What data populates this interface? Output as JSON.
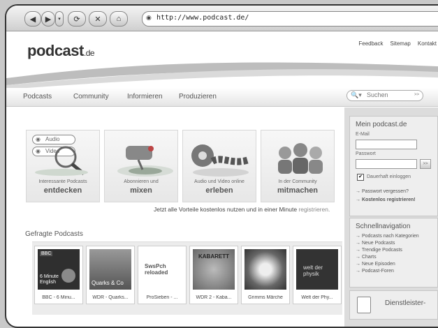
{
  "browser": {
    "url": "http://www.podcast.de/",
    "back_icon": "back-arrow-icon",
    "forward_icon": "forward-arrow-icon"
  },
  "header": {
    "logo_main": "podcast",
    "logo_suffix": ".de",
    "links": [
      "Feedback",
      "Sitemap",
      "Kontakt"
    ]
  },
  "nav": {
    "items": [
      "Podcasts",
      "Community",
      "Informieren",
      "Produzieren"
    ],
    "search_placeholder": "Suchen",
    "search_go": ">>"
  },
  "features": [
    {
      "small": "Interessante Podcasts",
      "big": "entdecken"
    },
    {
      "small": "Abonnieren und",
      "big": "mixen"
    },
    {
      "small": "Audio und Video online",
      "big": "erleben"
    },
    {
      "small": "In der Community",
      "big": "mitmachen"
    }
  ],
  "pills": {
    "audio": "Audio",
    "video": "Video"
  },
  "tagline": {
    "text": "Jetzt alle Vorteile kostenlos nutzen und in einer Minute",
    "link": "registrieren."
  },
  "podcasts_section": {
    "title": "Gefragte Podcasts",
    "items": [
      {
        "caption": "BBC - 6 Minu...",
        "art_text": "6 Minute English",
        "badge": "BBC"
      },
      {
        "caption": "WDR - Quarks...",
        "art_text": "Quarks & Co"
      },
      {
        "caption": "ProSieben - ...",
        "art_text": "SwsPch reloaded"
      },
      {
        "caption": "WDR 2 - Kaba...",
        "art_text": "KABARETT"
      },
      {
        "caption": "Grimms Märche",
        "art_text": ""
      },
      {
        "caption": "Welt der Phy...",
        "art_text": "welt der physik"
      }
    ]
  },
  "login": {
    "title": "Mein podcast.de",
    "email_label": "E-Mail",
    "password_label": "Passwort",
    "submit": ">>",
    "remember": "Dauerhaft einloggen",
    "forgot": "Passwort vergessen?",
    "register": "Kostenlos registrieren!"
  },
  "quicknav": {
    "title": "Schnellnavigation",
    "items": [
      "Podcasts nach Kategorien",
      "Neue Podcasts",
      "Trendige Podcasts",
      "Charts",
      "Neue Episoden",
      "Podcast-Foren"
    ]
  },
  "dienst": {
    "title": "Dienstleister-"
  }
}
